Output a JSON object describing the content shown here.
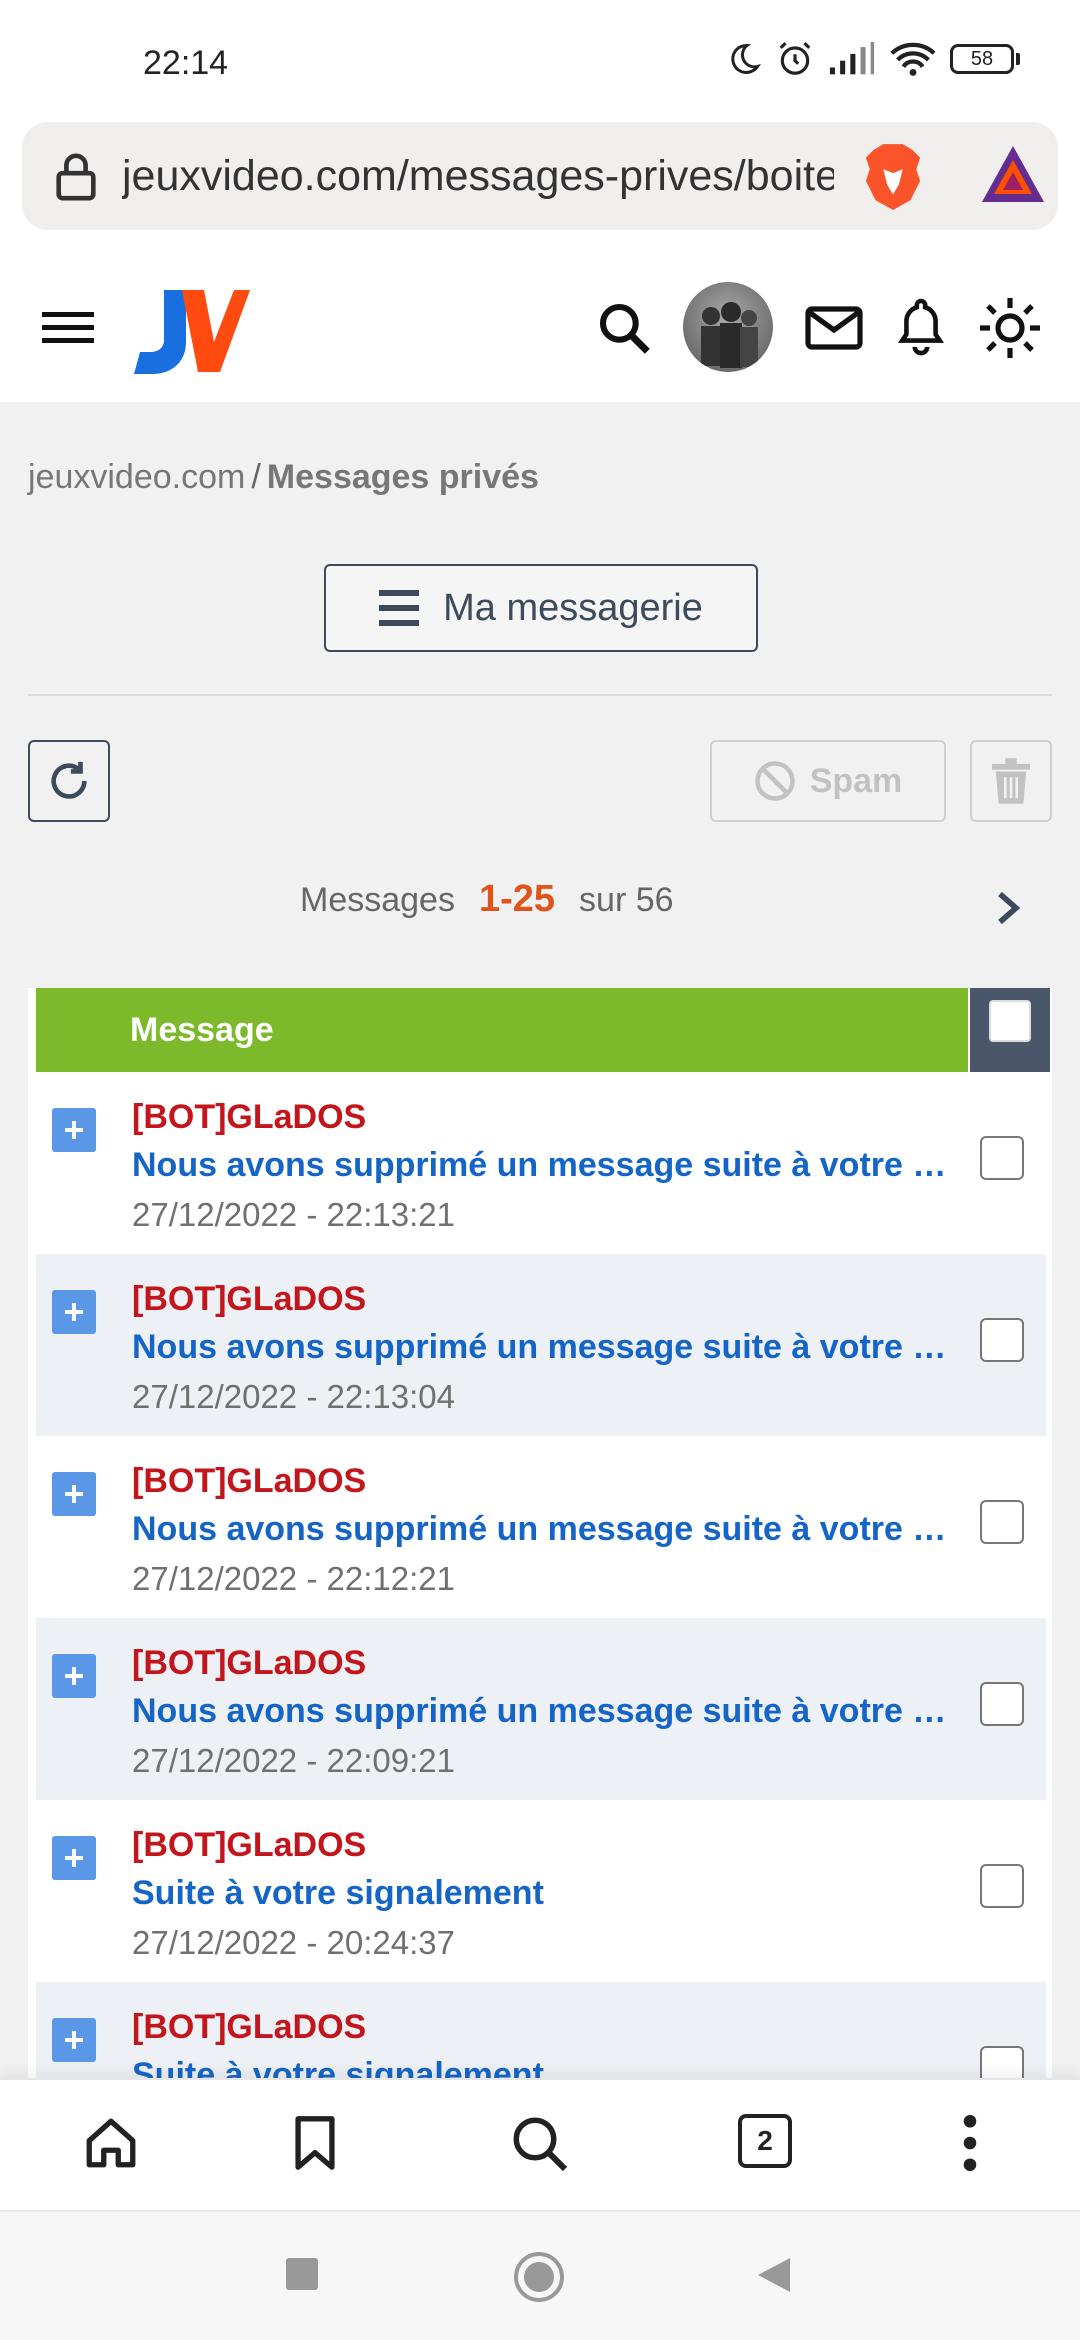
{
  "status_bar": {
    "time": "22:14",
    "battery": "58"
  },
  "browser": {
    "url": "jeuxvideo.com/messages-prives/boite-reception.php",
    "tabs_count": "2"
  },
  "breadcrumb": {
    "site": "jeuxvideo.com",
    "separator": "/",
    "current": "Messages privés"
  },
  "actions": {
    "messagerie_label": "Ma messagerie",
    "spam_label": "Spam"
  },
  "pagination": {
    "prefix": "Messages",
    "range": "1-25",
    "total": "sur 56"
  },
  "table": {
    "header": "Message",
    "rows": [
      {
        "author": "[BOT]GLaDOS",
        "subject": "Nous avons supprimé un message suite à votre signalement",
        "date": "27/12/2022 - 22:13:21"
      },
      {
        "author": "[BOT]GLaDOS",
        "subject": "Nous avons supprimé un message suite à votre signalement",
        "date": "27/12/2022 - 22:13:04"
      },
      {
        "author": "[BOT]GLaDOS",
        "subject": "Nous avons supprimé un message suite à votre signalement",
        "date": "27/12/2022 - 22:12:21"
      },
      {
        "author": "[BOT]GLaDOS",
        "subject": "Nous avons supprimé un message suite à votre signalement",
        "date": "27/12/2022 - 22:09:21"
      },
      {
        "author": "[BOT]GLaDOS",
        "subject": "Suite à votre signalement",
        "date": "27/12/2022 - 20:24:37"
      },
      {
        "author": "[BOT]GLaDOS",
        "subject": "Suite à votre signalement",
        "date": ""
      }
    ]
  },
  "colors": {
    "header_green": "#7cba2c",
    "author_red": "#c3161c",
    "subject_blue": "#1565c8",
    "range_orange": "#e0531b"
  },
  "icons": [
    "lock-icon",
    "brave-lion-icon",
    "bat-triangle-icon",
    "hamburger-icon",
    "jv-logo",
    "search-icon",
    "avatar",
    "mail-icon",
    "bell-icon",
    "theme-sun-icon",
    "list-icon",
    "refresh-icon",
    "spam-block-icon",
    "trash-icon",
    "chevron-right-icon",
    "plus-icon",
    "home-icon",
    "bookmark-icon",
    "tabs-icon",
    "more-vertical-icon",
    "recents-square-icon",
    "home-circle-icon",
    "back-triangle-icon"
  ]
}
